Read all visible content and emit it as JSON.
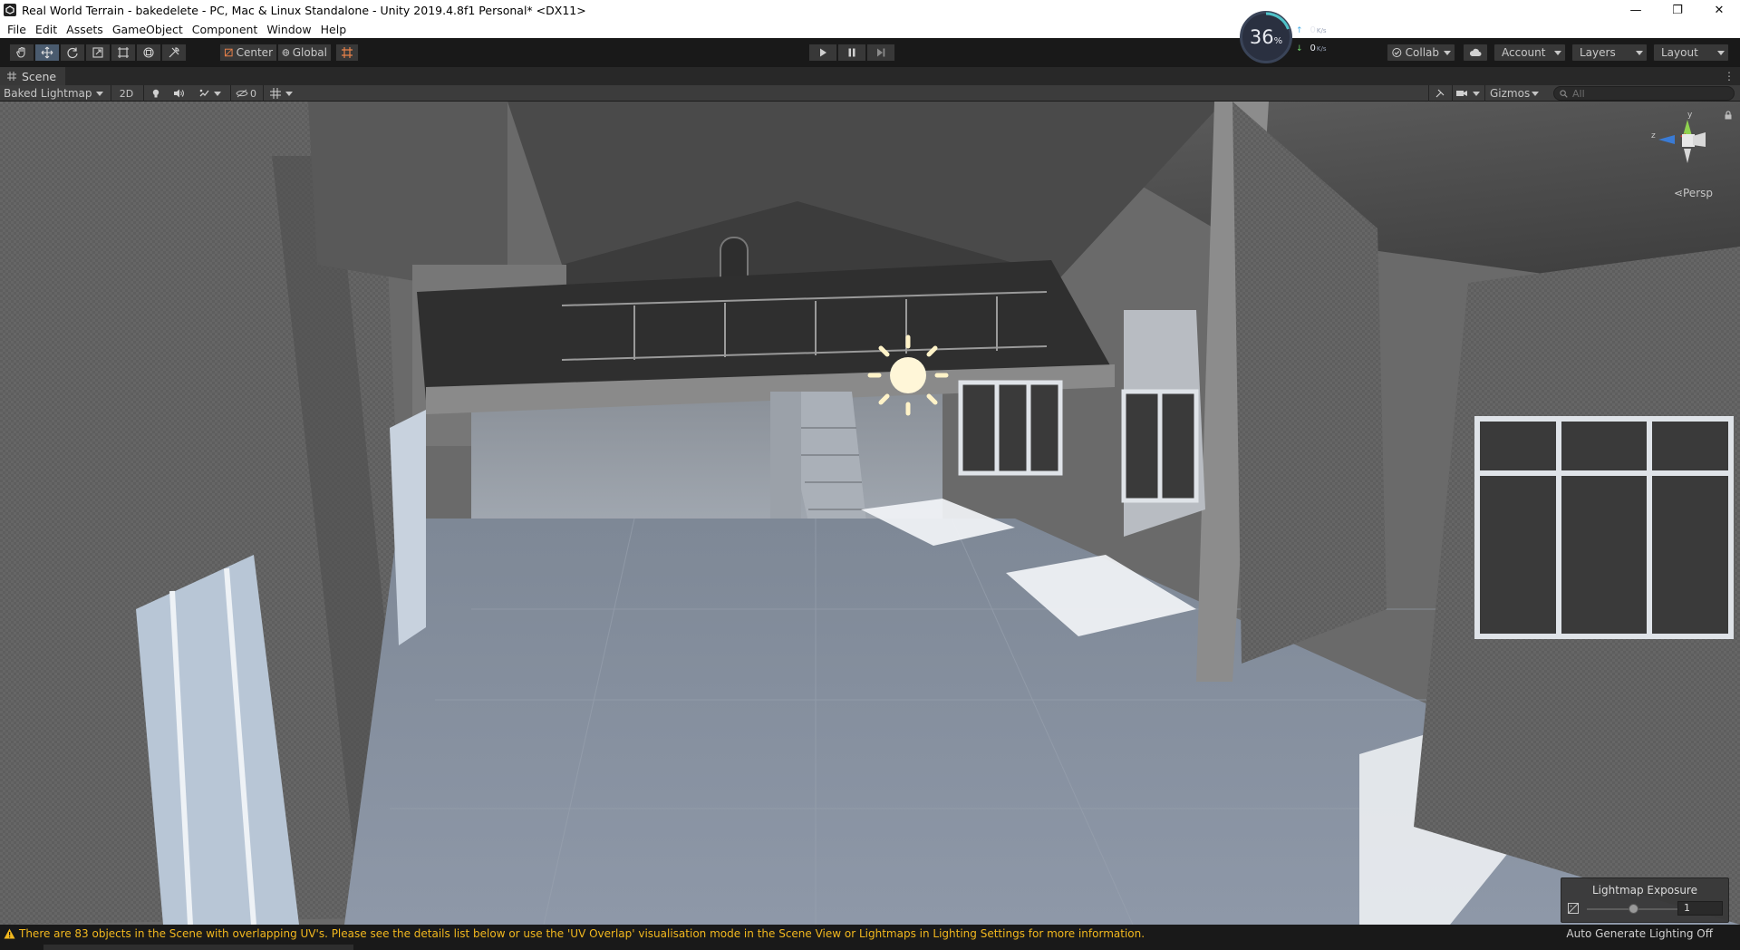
{
  "window": {
    "title": "Real World Terrain - bakedelete - PC, Mac & Linux Standalone - Unity 2019.4.8f1 Personal* <DX11>",
    "controls": [
      "—",
      "❐",
      "✕"
    ]
  },
  "menu": [
    "File",
    "Edit",
    "Assets",
    "GameObject",
    "Component",
    "Window",
    "Help"
  ],
  "toolbar": {
    "pivot_label": "Center",
    "space_label": "Global",
    "collab_label": "Collab",
    "account_label": "Account",
    "layers_label": "Layers",
    "layout_label": "Layout"
  },
  "perf": {
    "percent": "36",
    "percent_sign": "%",
    "upload": "0",
    "download": "0",
    "unit": "K/s"
  },
  "scene_tab": {
    "label": "Scene",
    "menu": "⋮"
  },
  "scene_toolbar": {
    "draw_mode": "Baked Lightmap",
    "mode_2d": "2D",
    "hidden_count": "0",
    "gizmos_label": "Gizmos",
    "search_placeholder": "All"
  },
  "gizmo": {
    "y": "y",
    "z": "z",
    "projection": "Persp"
  },
  "lightmap_exposure": {
    "title": "Lightmap Exposure",
    "value": "1",
    "slider_fraction": 0.45
  },
  "status": {
    "warning": "There are 83 objects in the Scene with overlapping UV's. Please see the details list below or use the 'UV Overlap' visualisation mode in the Scene View or Lightmaps in Lighting Settings for more information.",
    "right_text": "Auto Generate Lighting Off"
  },
  "colors": {
    "accent_active": "#4a5b6e",
    "warning": "#f2b81e",
    "gizmo_y": "#8fd14f",
    "gizmo_z": "#3a7bd5",
    "gizmo_x": "#d63a3a"
  }
}
